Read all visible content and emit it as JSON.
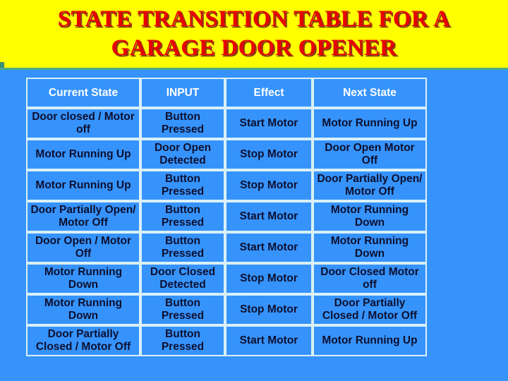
{
  "slide": {
    "background_color": "#3693fc",
    "title_banner_color": "#ffff00",
    "title_text_color": "#e80000",
    "title_shadow_color": "#8a3b10",
    "accent_line_color": "#4fa88a",
    "header_text_color": "#ffffff",
    "body_text_color": "#0d0f2e",
    "cell_border_color": "#d9f0f7"
  },
  "title": {
    "line1": "STATE TRANSITION TABLE FOR A",
    "line2": "GARAGE DOOR OPENER"
  },
  "table": {
    "headers": [
      "Current State",
      "INPUT",
      "Effect",
      "Next State"
    ],
    "rows": [
      {
        "current_state": "Door closed / Motor off",
        "input": "Button Pressed",
        "effect": "Start Motor",
        "next_state": "Motor Running Up"
      },
      {
        "current_state": "Motor Running Up",
        "input": "Door Open Detected",
        "effect": "Stop Motor",
        "next_state": "Door Open Motor Off"
      },
      {
        "current_state": "Motor Running Up",
        "input": "Button Pressed",
        "effect": "Stop Motor",
        "next_state": "Door Partially Open/ Motor Off"
      },
      {
        "current_state": "Door Partially Open/ Motor Off",
        "input": "Button Pressed",
        "effect": "Start Motor",
        "next_state": "Motor Running Down"
      },
      {
        "current_state": "Door Open / Motor Off",
        "input": "Button Pressed",
        "effect": "Start Motor",
        "next_state": "Motor Running Down"
      },
      {
        "current_state": "Motor Running Down",
        "input": "Door Closed Detected",
        "effect": "Stop Motor",
        "next_state": "Door Closed Motor off"
      },
      {
        "current_state": "Motor Running Down",
        "input": "Button Pressed",
        "effect": "Stop Motor",
        "next_state": "Door Partially Closed / Motor Off"
      },
      {
        "current_state": "Door Partially Closed / Motor Off",
        "input": "Button Pressed",
        "effect": "Start Motor",
        "next_state": "Motor Running Up"
      }
    ]
  }
}
